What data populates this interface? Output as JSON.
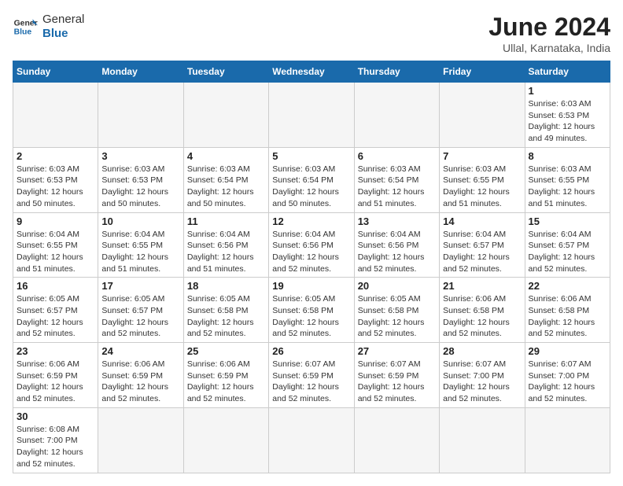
{
  "header": {
    "logo_general": "General",
    "logo_blue": "Blue",
    "title": "June 2024",
    "subtitle": "Ullal, Karnataka, India"
  },
  "days_of_week": [
    "Sunday",
    "Monday",
    "Tuesday",
    "Wednesday",
    "Thursday",
    "Friday",
    "Saturday"
  ],
  "weeks": [
    [
      {
        "day": "",
        "info": ""
      },
      {
        "day": "",
        "info": ""
      },
      {
        "day": "",
        "info": ""
      },
      {
        "day": "",
        "info": ""
      },
      {
        "day": "",
        "info": ""
      },
      {
        "day": "",
        "info": ""
      },
      {
        "day": "1",
        "info": "Sunrise: 6:03 AM\nSunset: 6:53 PM\nDaylight: 12 hours\nand 49 minutes."
      }
    ],
    [
      {
        "day": "2",
        "info": "Sunrise: 6:03 AM\nSunset: 6:53 PM\nDaylight: 12 hours\nand 50 minutes."
      },
      {
        "day": "3",
        "info": "Sunrise: 6:03 AM\nSunset: 6:53 PM\nDaylight: 12 hours\nand 50 minutes."
      },
      {
        "day": "4",
        "info": "Sunrise: 6:03 AM\nSunset: 6:54 PM\nDaylight: 12 hours\nand 50 minutes."
      },
      {
        "day": "5",
        "info": "Sunrise: 6:03 AM\nSunset: 6:54 PM\nDaylight: 12 hours\nand 50 minutes."
      },
      {
        "day": "6",
        "info": "Sunrise: 6:03 AM\nSunset: 6:54 PM\nDaylight: 12 hours\nand 51 minutes."
      },
      {
        "day": "7",
        "info": "Sunrise: 6:03 AM\nSunset: 6:55 PM\nDaylight: 12 hours\nand 51 minutes."
      },
      {
        "day": "8",
        "info": "Sunrise: 6:03 AM\nSunset: 6:55 PM\nDaylight: 12 hours\nand 51 minutes."
      }
    ],
    [
      {
        "day": "9",
        "info": "Sunrise: 6:04 AM\nSunset: 6:55 PM\nDaylight: 12 hours\nand 51 minutes."
      },
      {
        "day": "10",
        "info": "Sunrise: 6:04 AM\nSunset: 6:55 PM\nDaylight: 12 hours\nand 51 minutes."
      },
      {
        "day": "11",
        "info": "Sunrise: 6:04 AM\nSunset: 6:56 PM\nDaylight: 12 hours\nand 51 minutes."
      },
      {
        "day": "12",
        "info": "Sunrise: 6:04 AM\nSunset: 6:56 PM\nDaylight: 12 hours\nand 52 minutes."
      },
      {
        "day": "13",
        "info": "Sunrise: 6:04 AM\nSunset: 6:56 PM\nDaylight: 12 hours\nand 52 minutes."
      },
      {
        "day": "14",
        "info": "Sunrise: 6:04 AM\nSunset: 6:57 PM\nDaylight: 12 hours\nand 52 minutes."
      },
      {
        "day": "15",
        "info": "Sunrise: 6:04 AM\nSunset: 6:57 PM\nDaylight: 12 hours\nand 52 minutes."
      }
    ],
    [
      {
        "day": "16",
        "info": "Sunrise: 6:05 AM\nSunset: 6:57 PM\nDaylight: 12 hours\nand 52 minutes."
      },
      {
        "day": "17",
        "info": "Sunrise: 6:05 AM\nSunset: 6:57 PM\nDaylight: 12 hours\nand 52 minutes."
      },
      {
        "day": "18",
        "info": "Sunrise: 6:05 AM\nSunset: 6:58 PM\nDaylight: 12 hours\nand 52 minutes."
      },
      {
        "day": "19",
        "info": "Sunrise: 6:05 AM\nSunset: 6:58 PM\nDaylight: 12 hours\nand 52 minutes."
      },
      {
        "day": "20",
        "info": "Sunrise: 6:05 AM\nSunset: 6:58 PM\nDaylight: 12 hours\nand 52 minutes."
      },
      {
        "day": "21",
        "info": "Sunrise: 6:06 AM\nSunset: 6:58 PM\nDaylight: 12 hours\nand 52 minutes."
      },
      {
        "day": "22",
        "info": "Sunrise: 6:06 AM\nSunset: 6:58 PM\nDaylight: 12 hours\nand 52 minutes."
      }
    ],
    [
      {
        "day": "23",
        "info": "Sunrise: 6:06 AM\nSunset: 6:59 PM\nDaylight: 12 hours\nand 52 minutes."
      },
      {
        "day": "24",
        "info": "Sunrise: 6:06 AM\nSunset: 6:59 PM\nDaylight: 12 hours\nand 52 minutes."
      },
      {
        "day": "25",
        "info": "Sunrise: 6:06 AM\nSunset: 6:59 PM\nDaylight: 12 hours\nand 52 minutes."
      },
      {
        "day": "26",
        "info": "Sunrise: 6:07 AM\nSunset: 6:59 PM\nDaylight: 12 hours\nand 52 minutes."
      },
      {
        "day": "27",
        "info": "Sunrise: 6:07 AM\nSunset: 6:59 PM\nDaylight: 12 hours\nand 52 minutes."
      },
      {
        "day": "28",
        "info": "Sunrise: 6:07 AM\nSunset: 7:00 PM\nDaylight: 12 hours\nand 52 minutes."
      },
      {
        "day": "29",
        "info": "Sunrise: 6:07 AM\nSunset: 7:00 PM\nDaylight: 12 hours\nand 52 minutes."
      }
    ],
    [
      {
        "day": "30",
        "info": "Sunrise: 6:08 AM\nSunset: 7:00 PM\nDaylight: 12 hours\nand 52 minutes."
      },
      {
        "day": "",
        "info": ""
      },
      {
        "day": "",
        "info": ""
      },
      {
        "day": "",
        "info": ""
      },
      {
        "day": "",
        "info": ""
      },
      {
        "day": "",
        "info": ""
      },
      {
        "day": "",
        "info": ""
      }
    ]
  ]
}
